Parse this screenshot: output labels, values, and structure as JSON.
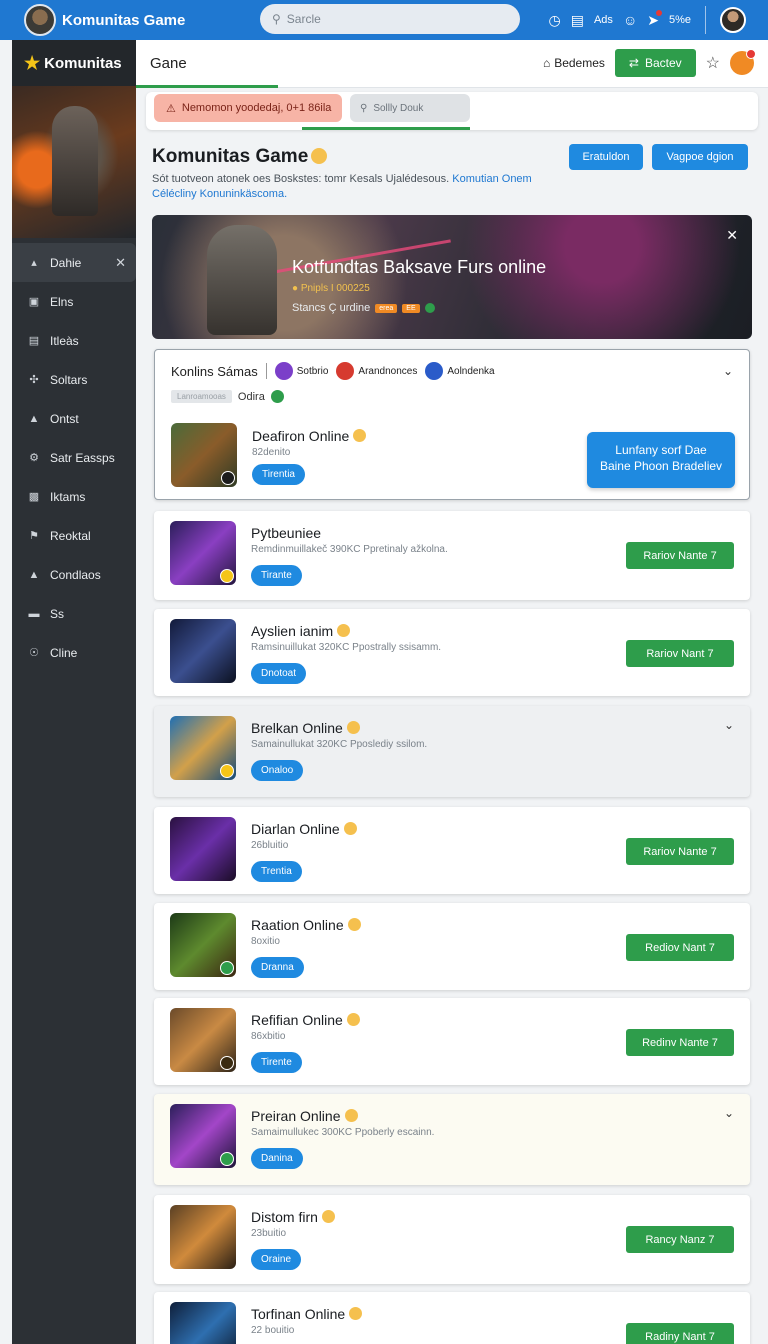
{
  "topbar": {
    "title": "Komunitas Game",
    "search_placeholder": "Sarcle",
    "ads_label": "Ads",
    "status_label": "5%e"
  },
  "sidebar": {
    "brand": "Komunitas",
    "items": [
      {
        "label": "Dahie",
        "icon": "home-icon",
        "active": true
      },
      {
        "label": "Elns",
        "icon": "grid-icon"
      },
      {
        "label": "Itleàs",
        "icon": "list-icon"
      },
      {
        "label": "Soltars",
        "icon": "puzzle-icon"
      },
      {
        "label": "Ontst",
        "icon": "people-icon"
      },
      {
        "label": "Satr Eassps",
        "icon": "settings-icon"
      },
      {
        "label": "Iktams",
        "icon": "image-icon"
      },
      {
        "label": "Reoktal",
        "icon": "flag-icon"
      },
      {
        "label": "Condlaos",
        "icon": "user-icon"
      },
      {
        "label": "Ss",
        "icon": "card-icon"
      },
      {
        "label": "Cline",
        "icon": "circle-icon"
      }
    ]
  },
  "header": {
    "title": "Gane",
    "bedemes": "Bedemes",
    "green_button": "Bactev"
  },
  "subbar": {
    "alert": "Nemomon yoodedaj, 0+1 86ila",
    "search": "Sollly Douk"
  },
  "page": {
    "title": "Komunitas Game",
    "desc": "Sót tuotveon atonek oes Boskstes: tomr Kesals Ujalédesous.",
    "desc_link": "Komutian Onem Célécliny Konuninkäscoma.",
    "btn1": "Eratuldon",
    "btn2": "Vagpoe dgion"
  },
  "banner": {
    "title": "Kotfundtas Baksave Furs online",
    "sub": "Pnipls I 000225",
    "status": "Stancs Ç urdine",
    "tag1": "erea",
    "tag2": "EE"
  },
  "filter": {
    "title": "Konlins Sámas",
    "c1": "Sotbrio",
    "c2": "Arandnonces",
    "c3": "Aolndenka",
    "chip": "Lanroamooas",
    "online": "Odira"
  },
  "featured": {
    "name": "Deafiron Online",
    "meta": "82denito",
    "tag": "Tirentia",
    "cta": "Lunfany sorf Dae Baine Phoon Bradeliev"
  },
  "games": [
    {
      "name": "Pytbeuniee",
      "desc": "Remdinmuillakeč 390KC Ppretinaly ažkolna.",
      "tag": "Tirante",
      "btn": "Rariov Nante 7",
      "bg": "#fff",
      "thumb": "linear-gradient(135deg,#2b1f5a,#8a3fc2 50%,#23163e)",
      "mini": "#f5c518",
      "emoji": false
    },
    {
      "name": "Ayslien ianim",
      "desc": "Ramsinuillukat 320KC Ppostrally ssisamm.",
      "tag": "Dnotoat",
      "btn": "Rariov Nant 7",
      "bg": "#fff",
      "thumb": "linear-gradient(135deg,#121a3a,#3b4f8f 50%,#0b1020)",
      "mini": null,
      "emoji": true
    },
    {
      "name": "Brelkan Online",
      "desc": "Samainullukat 320KC Pposlediy ssilom.",
      "tag": "Onaloo",
      "btn": null,
      "bg": "grey",
      "thumb": "linear-gradient(135deg,#1f6fb3,#d2a04a 50%,#134a7a)",
      "mini": "#f5c518",
      "emoji": true
    },
    {
      "name": "Diarlan Online",
      "desc": "26bluitio",
      "tag": "Trentia",
      "btn": "Rariov Nante 7",
      "bg": "#fff",
      "thumb": "linear-gradient(135deg,#2a1140,#6a2fa8 50%,#1a0c26)",
      "mini": null,
      "emoji": true
    },
    {
      "name": "Raation Online",
      "desc": "8oxitio",
      "tag": "Dranna",
      "btn": "Rediov Nant 7",
      "bg": "#fff",
      "thumb": "linear-gradient(135deg,#1d3a17,#5e8a2e 50%,#3a2410)",
      "mini": "#2e9d4b",
      "emoji": true
    },
    {
      "name": "Refifian Online",
      "desc": "86xbitio",
      "tag": "Tirente",
      "btn": "Redinv Nante 7",
      "bg": "#fff",
      "thumb": "linear-gradient(135deg,#6b4a2a,#c98a44 50%,#2e2418)",
      "mini": "#3a2a10",
      "emoji": true
    },
    {
      "name": "Preiran Online",
      "desc": "Samaimullukec 300KC Ppoberly escainn.",
      "tag": "Danina",
      "btn": null,
      "bg": "cream",
      "thumb": "linear-gradient(135deg,#2b1f5a,#a346c8 50%,#1b1337)",
      "mini": "#2e9d4b",
      "emoji": true
    },
    {
      "name": "Distom firn",
      "desc": "23buitio",
      "tag": "Oraine",
      "btn": "Rancy Nanz 7",
      "bg": "#fff",
      "thumb": "linear-gradient(135deg,#5a4024,#d08a3c 50%,#2a1f14)",
      "mini": null,
      "emoji": true
    },
    {
      "name": "Torfinan Online",
      "desc": "22 bouitio",
      "tag": "",
      "btn": "Radiny Nant 7",
      "bg": "#fff",
      "thumb": "linear-gradient(135deg,#0f1f3a,#2e6fb0 50%,#0a1222)",
      "mini": null,
      "emoji": true
    }
  ]
}
